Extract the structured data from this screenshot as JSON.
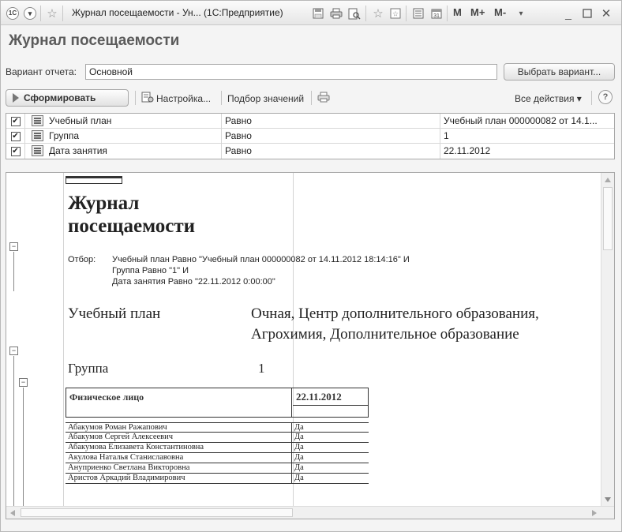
{
  "window": {
    "app_icon": "1C",
    "title": "Журнал посещаемости - Ун... (1С:Предприятие)",
    "title_letters": [
      "M",
      "M+",
      "M-"
    ],
    "icons": [
      "app-logo-icon",
      "dropdown-arrow-icon",
      "star-icon",
      "save-icon",
      "print-icon",
      "preview-icon",
      "favorites-add-icon",
      "favorites-icon",
      "calculator-icon",
      "calendar-icon",
      "menu-arrow-icon",
      "minimize-icon",
      "maximize-icon",
      "close-icon"
    ]
  },
  "form": {
    "title": "Журнал посещаемости",
    "variant_label": "Вариант отчета:",
    "variant_value": "Основной",
    "choose_variant": "Выбрать вариант..."
  },
  "toolbar": {
    "generate": "Сформировать",
    "settings": "Настройка...",
    "values_selection": "Подбор значений",
    "all_actions": "Все действия ▾",
    "help": "?"
  },
  "settings_rows": [
    {
      "checked": "✔",
      "name": "Учебный план",
      "comparison": "Равно",
      "value": "Учебный план 000000082 от 14.1..."
    },
    {
      "checked": "✔",
      "name": "Группа",
      "comparison": "Равно",
      "value": "1"
    },
    {
      "checked": "✔",
      "name": "Дата занятия",
      "comparison": "Равно",
      "value": "22.11.2012"
    }
  ],
  "report": {
    "title_line1": "Журнал",
    "title_line2": "посещаемости",
    "filter_label": "Отбор:",
    "filter_lines": [
      "Учебный план Равно \"Учебный план 000000082 от 14.11.2012 18:14:16\" И",
      "Группа Равно \"1\" И",
      "Дата занятия Равно \"22.11.2012 0:00:00\""
    ],
    "plan_label": "Учебный план",
    "plan_value_line1": "Очная, Центр дополнительного образования,",
    "plan_value_line2": "Агрохимия, Дополнительное образование",
    "group_label": "Группа",
    "group_value": "1",
    "table_header_person": "Физическое лицо",
    "table_header_date": "22.11.2012",
    "rows": [
      {
        "name": "Абакумов Роман Ражапович",
        "mark": "Да"
      },
      {
        "name": "Абакумов Сергей Алексеевич",
        "mark": "Да"
      },
      {
        "name": "Абакумова Елизавета Константиновна",
        "mark": "Да"
      },
      {
        "name": "Акулова Наталья Станиславовна",
        "mark": "Да"
      },
      {
        "name": "Ануприенко Светлана Викторовна",
        "mark": "Да"
      },
      {
        "name": "Аристов Аркадий Владимирович",
        "mark": "Да"
      }
    ]
  }
}
